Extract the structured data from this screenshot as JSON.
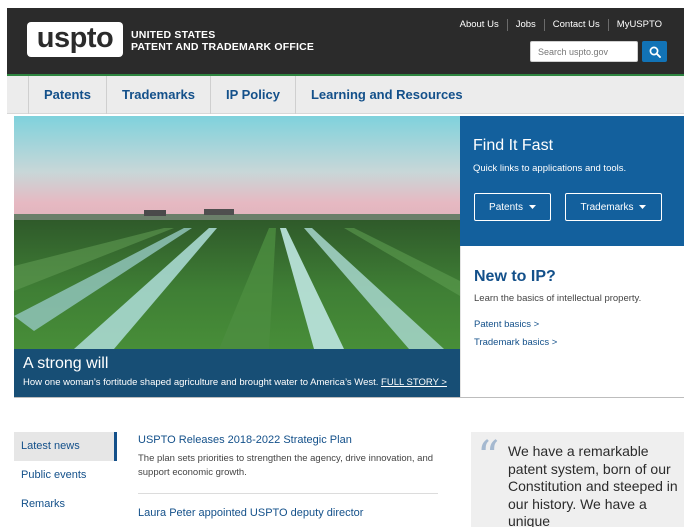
{
  "header": {
    "logo_text": "uspto",
    "agency_line1": "UNITED STATES",
    "agency_line2": "PATENT AND TRADEMARK OFFICE",
    "utility_links": [
      "About Us",
      "Jobs",
      "Contact Us",
      "MyUSPTO"
    ],
    "search_placeholder": "Search uspto.gov"
  },
  "nav": {
    "items": [
      "Patents",
      "Trademarks",
      "IP Policy",
      "Learning and Resources"
    ]
  },
  "hero": {
    "title": "A strong will",
    "text": "How one woman’s fortitude shaped agriculture and brought water to America’s West.",
    "link": "FULL STORY >"
  },
  "find_it_fast": {
    "title": "Find It Fast",
    "subtitle": "Quick links to applications and tools.",
    "buttons": [
      "Patents",
      "Trademarks"
    ]
  },
  "new_to_ip": {
    "title": "New to IP?",
    "subtitle": "Learn the basics of intellectual property.",
    "links": [
      "Patent basics >",
      "Trademark basics >"
    ]
  },
  "sidenav": {
    "items": [
      "Latest news",
      "Public events",
      "Remarks"
    ]
  },
  "news": [
    {
      "title": "USPTO Releases 2018-2022 Strategic Plan",
      "text": "The plan sets priorities to strengthen the agency, drive innovation, and support economic growth."
    },
    {
      "title": "Laura Peter appointed USPTO deputy director",
      "text": ""
    }
  ],
  "quote": {
    "mark": "“",
    "text": "We have a remarkable patent system, born of our Constitution and steeped in our history. We have a unique"
  },
  "colors": {
    "header_bg": "#2b2b2b",
    "accent_blue": "#13609d",
    "link_blue": "#13508a",
    "nav_border_green": "#2e8540"
  }
}
